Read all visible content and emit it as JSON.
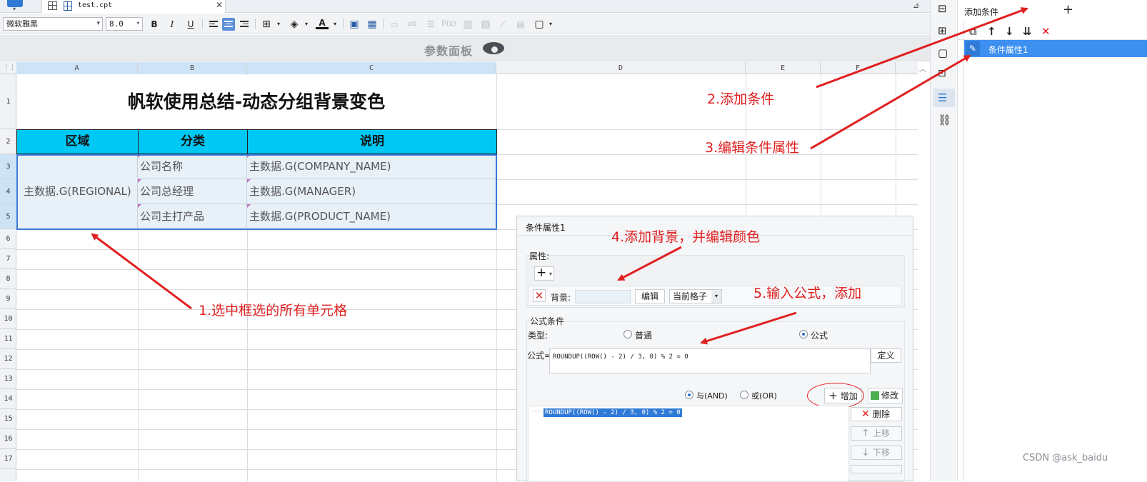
{
  "tabbar": {
    "file_name": "test.cpt",
    "close_glyph": "✕",
    "pin_glyph": "⊿"
  },
  "toolbar": {
    "font_family": "微软雅黑",
    "font_size": "8.0",
    "bold_label": "B",
    "italic_label": "I",
    "underline_label": "U",
    "formula_label": "F(x)",
    "text_ab_label": "ab"
  },
  "param_panel": {
    "label": "参数面板"
  },
  "columns": [
    "A",
    "B",
    "C",
    "D",
    "E",
    "F"
  ],
  "rows": [
    "1",
    "2",
    "3",
    "4",
    "5",
    "6",
    "7",
    "8",
    "9",
    "10",
    "11",
    "12",
    "13",
    "14",
    "15",
    "16",
    "17"
  ],
  "report": {
    "title": "帆软使用总结-动态分组背景变色",
    "headers": [
      "区域",
      "分类",
      "说明"
    ],
    "region_cell": "主数据.G(REGIONAL)",
    "category_cells": [
      "公司名称",
      "公司总经理",
      "公司主打产品"
    ],
    "desc_cells": [
      "主数据.G(COMPANY_NAME)",
      "主数据.G(MANAGER)",
      "主数据.G(PRODUCT_NAME)"
    ],
    "header_bg": "#00c8f5",
    "data_bg": "#e8f0f8"
  },
  "right_panel": {
    "title": "添加条件",
    "add_glyph": "+",
    "item_label": "条件属性1"
  },
  "dialog": {
    "title": "条件属性1",
    "attributes_label": "属性:",
    "add_glyph": "+",
    "background_label": "背景:",
    "edit_button": "编辑",
    "scope_value": "当前格子",
    "formula_group_label": "公式条件",
    "type_label": "类型:",
    "type_normal": "普通",
    "type_formula": "公式",
    "formula_label": "公式=",
    "formula_value": "ROUNDUP((ROW() - 2) / 3, 0) % 2 = 0",
    "define_button": "定义",
    "and_label": "与(AND)",
    "or_label": "或(OR)",
    "add_button": "增加",
    "modify_button": "修改",
    "condition_item": "ROUNDUP((ROW() - 2) / 3, 0) % 2 = 0",
    "delete_button": "删除",
    "up_button": "上移",
    "down_button": "下移"
  },
  "annotations": {
    "step1": "1.选中框选的所有单元格",
    "step2": "2.添加条件",
    "step3": "3.编辑条件属性",
    "step4": "4.添加背景，并编辑颜色",
    "step5": "5.输入公式，添加"
  },
  "watermark": "CSDN @ask_baidu",
  "colors": {
    "accent": "#3d8ff0",
    "annotation": "#e02020"
  }
}
